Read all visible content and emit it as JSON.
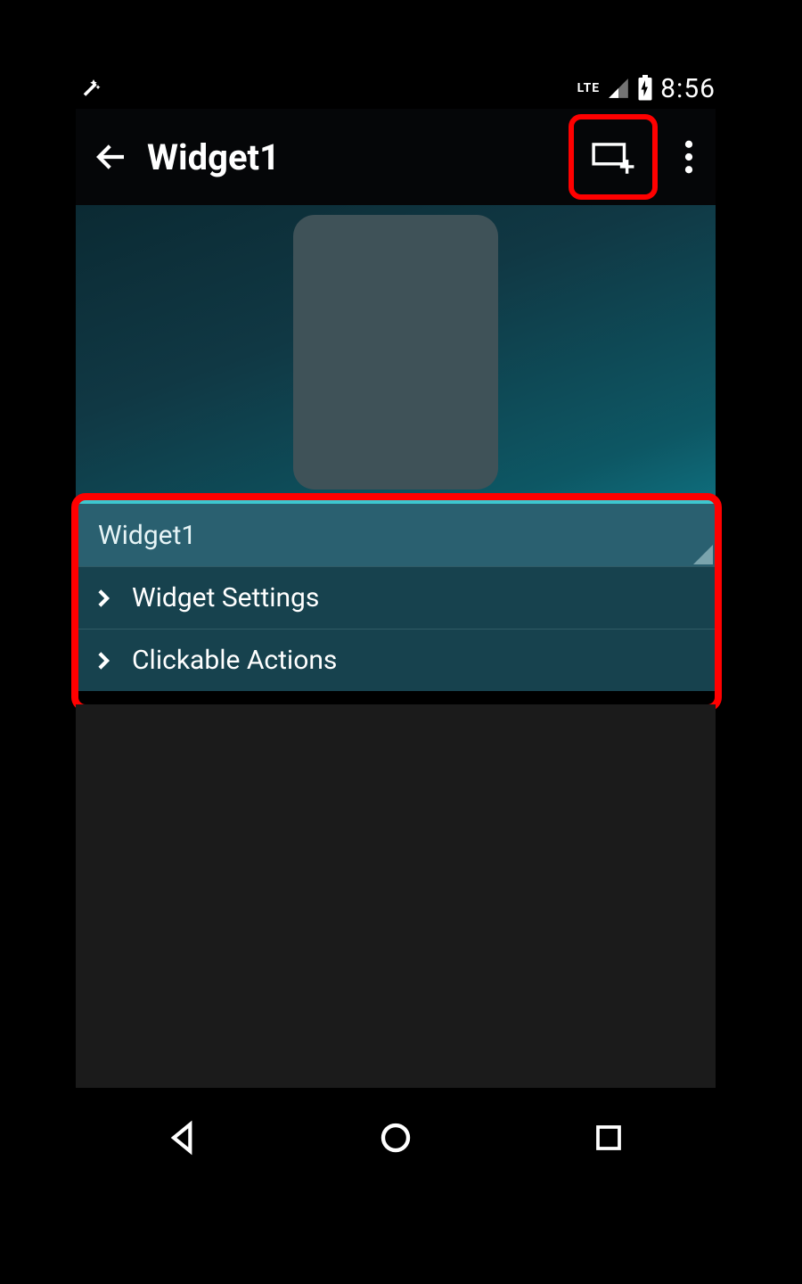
{
  "status": {
    "network": "LTE",
    "time": "8:56"
  },
  "appbar": {
    "title": "Widget1"
  },
  "dropdown": {
    "selected": "Widget1"
  },
  "rows": [
    {
      "label": "Widget Settings"
    },
    {
      "label": "Clickable Actions"
    }
  ],
  "icons": {
    "wand": "wand-icon",
    "signal": "signal-icon",
    "battery": "battery-charging-icon",
    "back": "back-arrow-icon",
    "add_widget": "add-widget-icon",
    "more": "more-vert-icon",
    "nav_back": "nav-back-icon",
    "nav_home": "nav-home-icon",
    "nav_recent": "nav-recent-icon"
  }
}
